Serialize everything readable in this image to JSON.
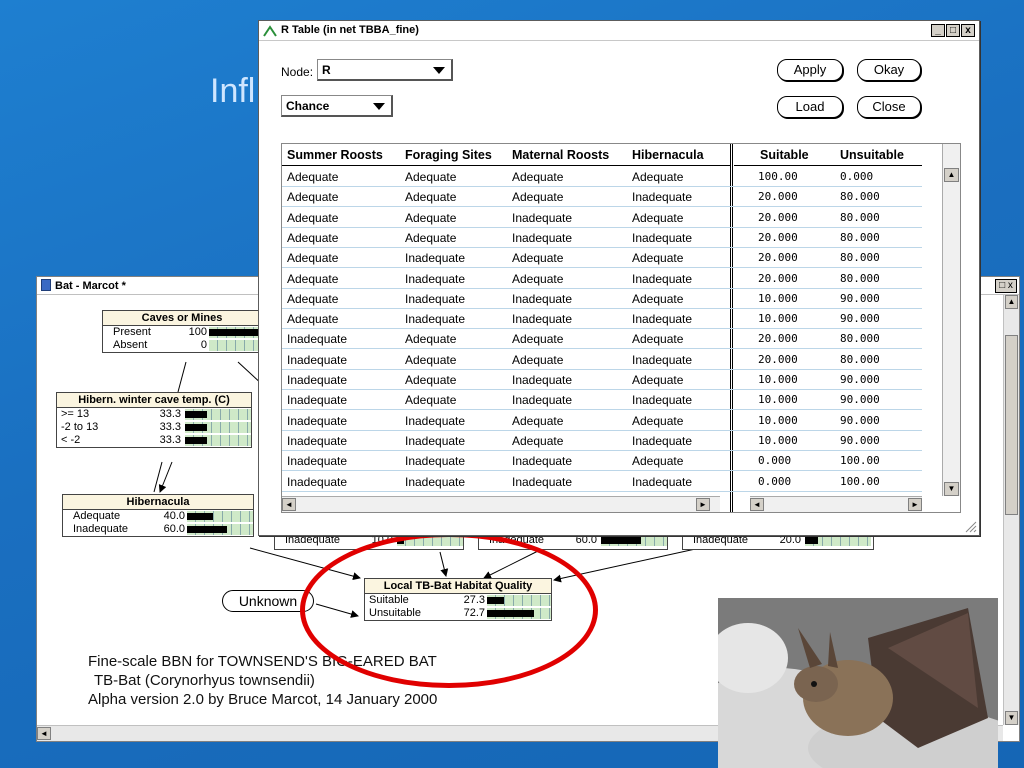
{
  "slide": {
    "title_fragment": "Infl"
  },
  "bat_window": {
    "title": "Bat - Marcot *",
    "close_glyph": "□ x"
  },
  "nodes": {
    "caves": {
      "title": "Caves or Mines",
      "states": [
        {
          "label": "Present",
          "value": "100",
          "fraction": 1.0
        },
        {
          "label": "Absent",
          "value": "0",
          "fraction": 0.0
        }
      ]
    },
    "winter_temp": {
      "title": "Hibern. winter cave temp. (C)",
      "states": [
        {
          "label": ">= 13",
          "value": "33.3",
          "fraction": 0.333
        },
        {
          "label": "-2 to 13",
          "value": "33.3",
          "fraction": 0.333
        },
        {
          "label": "< -2",
          "value": "33.3",
          "fraction": 0.333
        }
      ]
    },
    "hibernacula": {
      "title": "Hibernacula",
      "states": [
        {
          "label": "Adequate",
          "value": "40.0",
          "fraction": 0.4
        },
        {
          "label": "Inadequate",
          "value": "60.0",
          "fraction": 0.6
        }
      ]
    },
    "partial1": {
      "label": "Inadequate",
      "value": "10.0",
      "fraction": 0.1
    },
    "partial2": {
      "label": "Inadequate",
      "value": "60.0",
      "fraction": 0.6
    },
    "partial3": {
      "label": "Inadequate",
      "value": "20.0",
      "fraction": 0.2
    },
    "habitat": {
      "title": "Local TB-Bat Habitat Quality",
      "states": [
        {
          "label": "Suitable",
          "value": "27.3",
          "fraction": 0.273
        },
        {
          "label": "Unsuitable",
          "value": "72.7",
          "fraction": 0.727
        }
      ]
    },
    "unknown": "Unknown"
  },
  "caption": {
    "line1": "Fine-scale BBN for TOWNSEND'S BIG-EARED BAT",
    "line2": "TB-Bat  (Corynorhyus townsendii)",
    "line3": "Alpha version 2.0 by Bruce Marcot, 14 January 2000"
  },
  "rtable": {
    "title": "R Table (in net TBBA_fine)",
    "window_buttons": [
      "_",
      "□",
      "x"
    ],
    "node_label": "Node:",
    "node_value": "R",
    "type_value": "Chance",
    "buttons": {
      "apply": "Apply",
      "okay": "Okay",
      "load": "Load",
      "close": "Close"
    },
    "headers": [
      "Summer Roosts",
      "Foraging Sites",
      "Maternal Roosts",
      "Hibernacula",
      "Suitable",
      "Unsuitable"
    ],
    "rows": [
      [
        "Adequate",
        "Adequate",
        "Adequate",
        "Adequate",
        "100.00",
        "0.000"
      ],
      [
        "Adequate",
        "Adequate",
        "Adequate",
        "Inadequate",
        "20.000",
        "80.000"
      ],
      [
        "Adequate",
        "Adequate",
        "Inadequate",
        "Adequate",
        "20.000",
        "80.000"
      ],
      [
        "Adequate",
        "Adequate",
        "Inadequate",
        "Inadequate",
        "20.000",
        "80.000"
      ],
      [
        "Adequate",
        "Inadequate",
        "Adequate",
        "Adequate",
        "20.000",
        "80.000"
      ],
      [
        "Adequate",
        "Inadequate",
        "Adequate",
        "Inadequate",
        "20.000",
        "80.000"
      ],
      [
        "Adequate",
        "Inadequate",
        "Inadequate",
        "Adequate",
        "10.000",
        "90.000"
      ],
      [
        "Adequate",
        "Inadequate",
        "Inadequate",
        "Inadequate",
        "10.000",
        "90.000"
      ],
      [
        "Inadequate",
        "Adequate",
        "Adequate",
        "Adequate",
        "20.000",
        "80.000"
      ],
      [
        "Inadequate",
        "Adequate",
        "Adequate",
        "Inadequate",
        "20.000",
        "80.000"
      ],
      [
        "Inadequate",
        "Adequate",
        "Inadequate",
        "Adequate",
        "10.000",
        "90.000"
      ],
      [
        "Inadequate",
        "Adequate",
        "Inadequate",
        "Inadequate",
        "10.000",
        "90.000"
      ],
      [
        "Inadequate",
        "Inadequate",
        "Adequate",
        "Adequate",
        "10.000",
        "90.000"
      ],
      [
        "Inadequate",
        "Inadequate",
        "Adequate",
        "Inadequate",
        "10.000",
        "90.000"
      ],
      [
        "Inadequate",
        "Inadequate",
        "Inadequate",
        "Adequate",
        "0.000",
        "100.00"
      ],
      [
        "Inadequate",
        "Inadequate",
        "Inadequate",
        "Inadequate",
        "0.000",
        "100.00"
      ]
    ]
  },
  "colors": {
    "slide_bg": "#1a6fc0",
    "node_title_bg": "#fbf5e0",
    "bar_bg": "#cfe9c8",
    "highlight": "#e00000"
  },
  "icons": [
    "app-icon",
    "net-icon",
    "dropdown-arrow-icon",
    "scroll-up-icon",
    "scroll-down-icon",
    "scroll-left-icon",
    "scroll-right-icon",
    "resize-grip-icon"
  ]
}
